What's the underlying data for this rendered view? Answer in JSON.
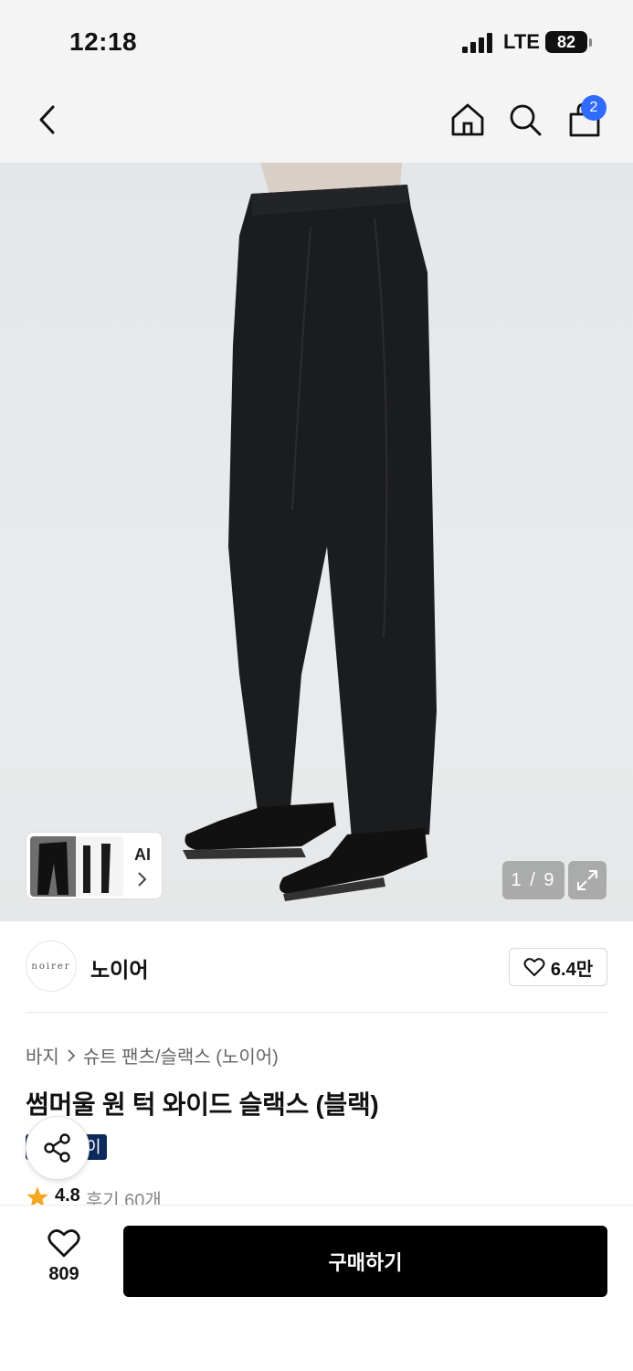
{
  "status_bar": {
    "time": "12:18",
    "network": "LTE",
    "battery": "82"
  },
  "nav": {
    "back_icon": "chevron-left-icon",
    "home_icon": "home-icon",
    "search_icon": "search-icon",
    "cart_icon": "shopping-bag-icon",
    "cart_badge": "2"
  },
  "gallery": {
    "thumb_label": "AI",
    "counter": "1 / 9",
    "expand_icon": "expand-icon"
  },
  "brand": {
    "logo_text": "noirer",
    "name": "노이어",
    "likes": "6.4만"
  },
  "product": {
    "breadcrumb": [
      "바지",
      "슈트 팬츠/슬랙스 (노이어)"
    ],
    "title": "썸머울 원 턱 와이드 슬랙스 (블랙)",
    "tag_visible": "이",
    "rating": "4.8",
    "reviews": "후기 60개"
  },
  "actions": {
    "wish_count": "809",
    "buy_label": "구매하기"
  },
  "colors": {
    "accent_blue": "#2f6bff",
    "tag_navy": "#0d2a5a",
    "star": "#f5a623"
  }
}
